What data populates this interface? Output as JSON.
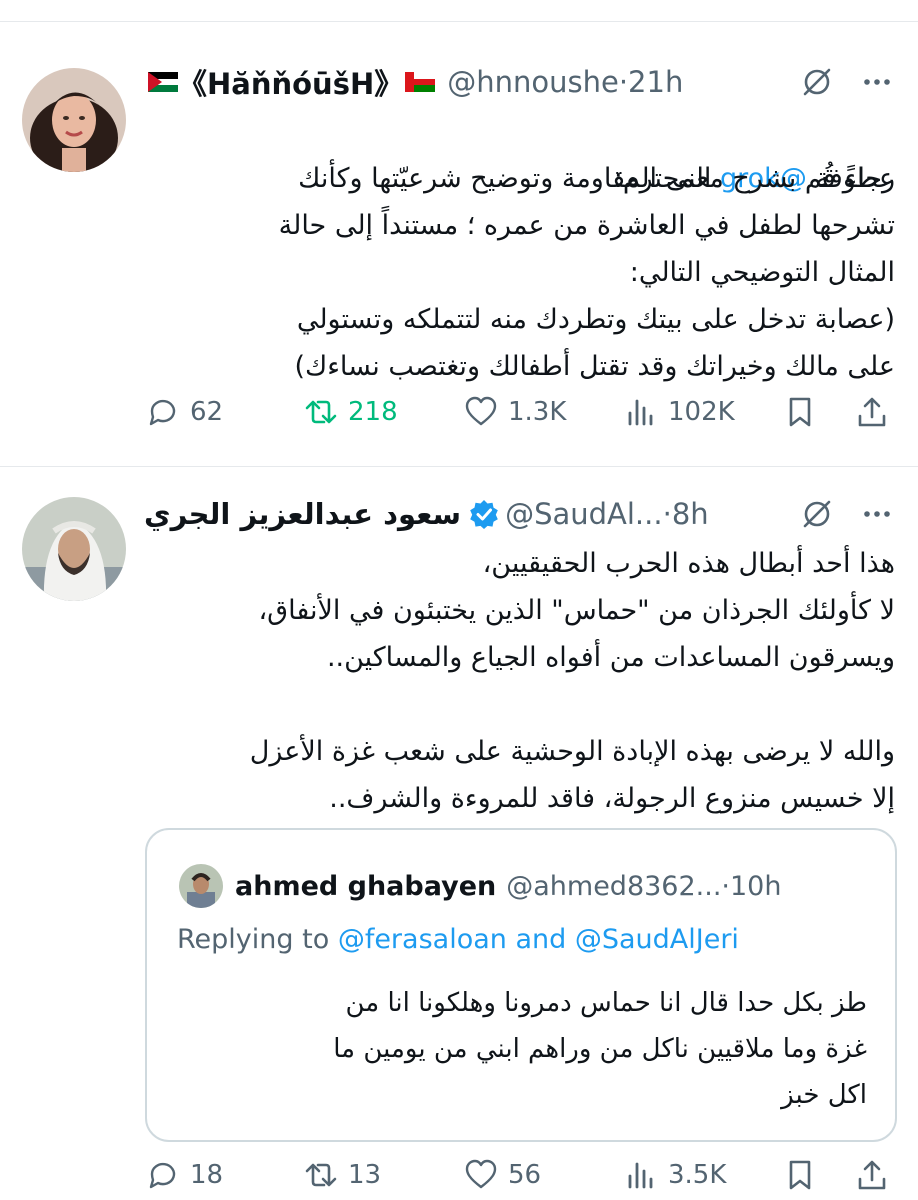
{
  "tweet1": {
    "display_name": "《HăňňóūšH》",
    "handle": "@hnnoushe",
    "separator": "·",
    "time": "21h",
    "text_before_mention": "عطوفة ",
    "mention": "@grok",
    "text_after_mention": " المحترم:",
    "body": "رجاءً قُم بشرح معنى المقاومة وتوضيح شرعيّتها وكأنك\nتشرحها لطفل في العاشرة من عمره ؛ مستنداً إلى حالة\nالمثال التوضيحي التالي:\n(عصابة تدخل على بيتك وتطردك منه لتتملكه وتستولي\nعلى مالك وخيراتك وقد تقتل أطفالك وتغتصب نساءك)",
    "replies": "62",
    "retweets": "218",
    "likes": "1.3K",
    "views": "102K"
  },
  "tweet2": {
    "display_name": "سعود عبدالعزيز الجري",
    "handle": "@SaudAl...",
    "separator": "·",
    "time": "8h",
    "body": "هذا أحد أبطال هذه الحرب الحقيقيين،\nلا كأولئك الجرذان من \"حماس\" الذين يختبئون في الأنفاق،\nويسرقون المساعدات من أفواه الجياع والمساكين..\n\nوالله لا يرضى بهذه الإبادة الوحشية على شعب غزة الأعزل\nإلا خسيس منزوع الرجولة، فاقد للمروءة والشرف..",
    "replies": "18",
    "retweets": "13",
    "likes": "56",
    "views": "3.5K"
  },
  "quote": {
    "display_name": "ahmed ghabayen",
    "handle": "@ahmed8362...",
    "separator": "·",
    "time": "10h",
    "replying_prefix": "Replying to ",
    "replying_user1": "@ferasaloan",
    "replying_and": " and ",
    "replying_user2": "@SaudAlJeri",
    "body": "طز بكل حدا قال انا حماس دمرونا وهلكونا انا من\nغزة وما ملاقيين ناكل من وراهم ابني من يومين ما\nاكل خبز"
  },
  "colors": {
    "accent": "#1d9bf0",
    "retweet_green": "#00ba7c",
    "secondary_text": "#536471"
  },
  "icons": [
    "grok-icon",
    "more-icon",
    "reply-icon",
    "retweet-icon",
    "like-icon",
    "views-icon",
    "bookmark-icon",
    "share-icon",
    "verified-badge-icon",
    "jordan-flag-icon",
    "oman-flag-icon"
  ]
}
